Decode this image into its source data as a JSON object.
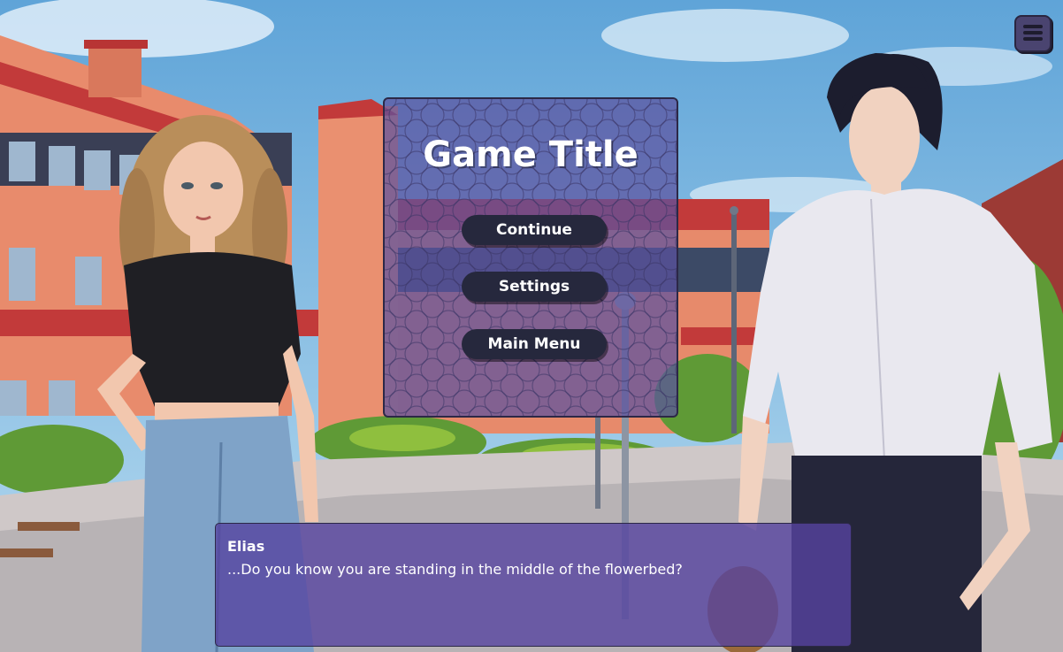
{
  "game": {
    "title": "Game Title"
  },
  "pause_menu": {
    "buttons": [
      {
        "label": "Continue"
      },
      {
        "label": "Settings"
      },
      {
        "label": "Main Menu"
      }
    ]
  },
  "hud": {
    "menu_icon": "hamburger-menu-icon"
  },
  "dialogue": {
    "speaker": "Elias",
    "text": "...Do you know you are standing in the middle of the flowerbed?"
  },
  "colors": {
    "panel": "#5c52a0",
    "button": "#26283d",
    "dialogue_box": "#5644a0",
    "text": "#ffffff"
  }
}
